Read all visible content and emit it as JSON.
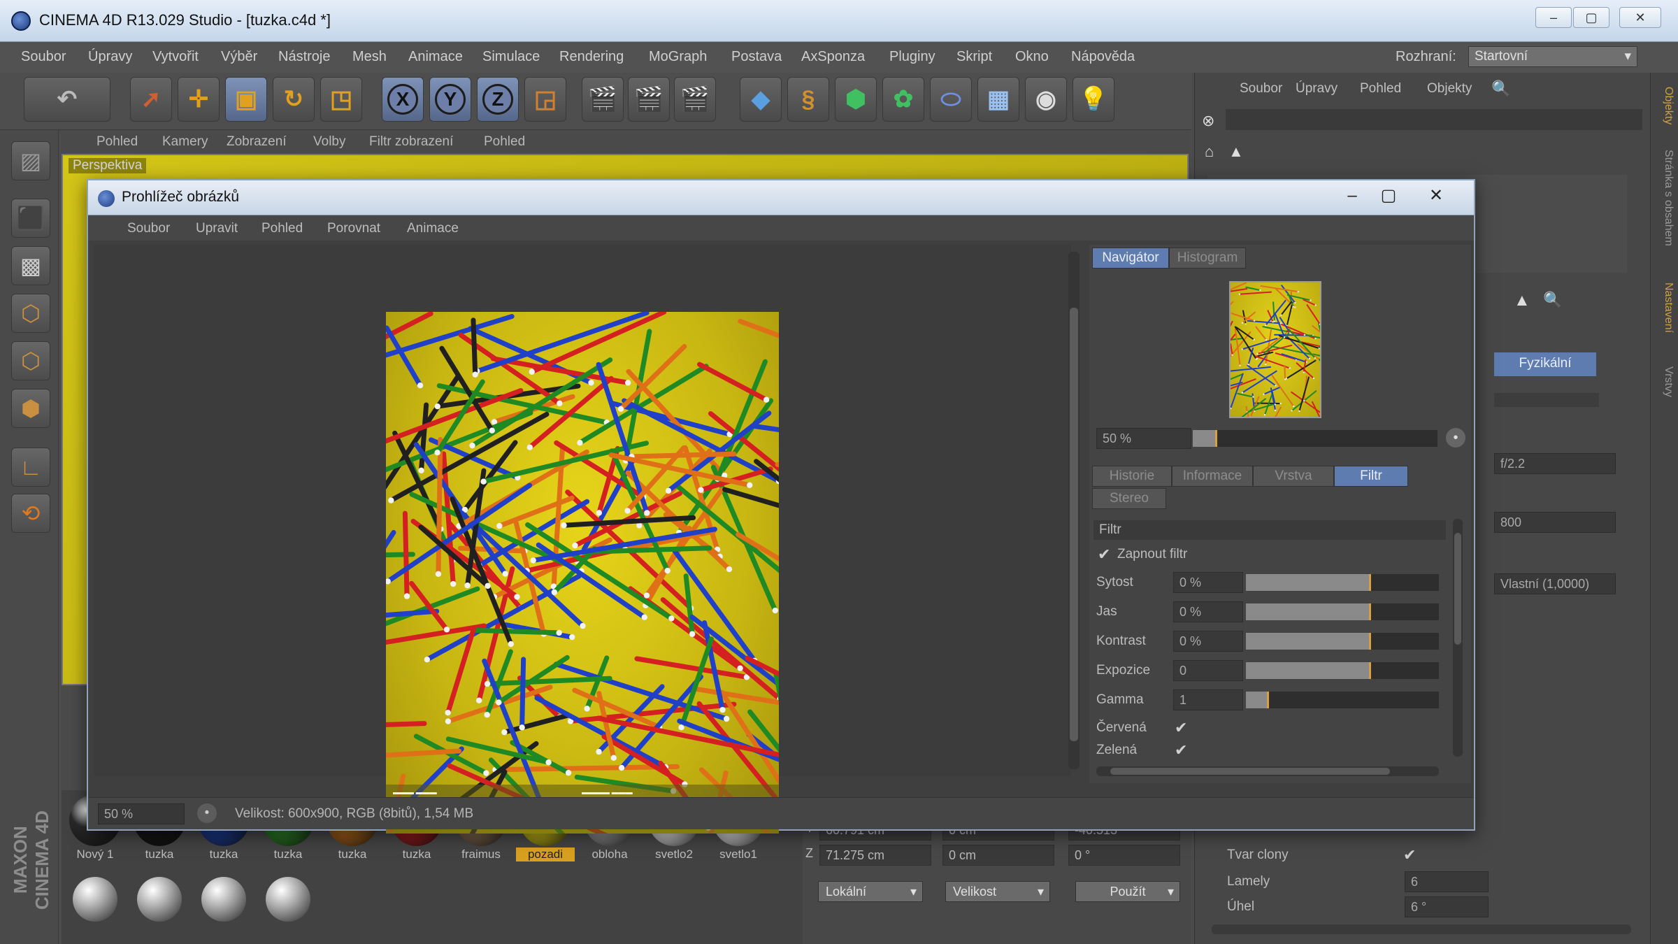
{
  "app": {
    "title": "CINEMA 4D R13.029 Studio - [tuzka.c4d *]",
    "window_controls": [
      "–",
      "▢",
      "✕"
    ]
  },
  "menubar": {
    "items": [
      "Soubor",
      "Úpravy",
      "Vytvořit",
      "Výběr",
      "Nástroje",
      "Mesh",
      "Animace",
      "Simulace",
      "Rendering",
      "MoGraph",
      "Postava",
      "AxSponza",
      "Pluginy",
      "Skript",
      "Okno",
      "Nápověda"
    ],
    "layout_label": "Rozhraní:",
    "layout_value": "Startovní"
  },
  "toolbar": {
    "axis_x": "X",
    "axis_y": "Y",
    "axis_z": "Z"
  },
  "viewport": {
    "menu": [
      "Pohled",
      "Kamery",
      "Zobrazení",
      "Volby",
      "Filtr zobrazení",
      "Pohled"
    ],
    "label": "Perspektiva"
  },
  "viewer": {
    "title": "Prohlížeč obrázků",
    "menu": [
      "Soubor",
      "Upravit",
      "Pohled",
      "Porovnat",
      "Animace"
    ],
    "panel_tabs": [
      "Navigátor",
      "Histogram"
    ],
    "zoom_value": "50 %",
    "zoom_fraction": 0.1,
    "section_tabs": [
      "Historie",
      "Informace",
      "Vrstva",
      "Filtr"
    ],
    "section_tab_active": "Filtr",
    "second_row_tab": "Stereo",
    "filter_header": "Filtr",
    "enable_filter_label": "Zapnout filtr",
    "enable_filter_checked": true,
    "filters": [
      {
        "label": "Sytost",
        "value": "0 %",
        "fraction": 0.65
      },
      {
        "label": "Jas",
        "value": "0 %",
        "fraction": 0.65
      },
      {
        "label": "Kontrast",
        "value": "0 %",
        "fraction": 0.65
      },
      {
        "label": "Expozice",
        "value": "0",
        "fraction": 0.65
      },
      {
        "label": "Gamma",
        "value": "1",
        "fraction": 0.12
      }
    ],
    "channels": [
      {
        "label": "Červená",
        "checked": true
      },
      {
        "label": "Zelená",
        "checked": true
      }
    ],
    "status_zoom": "50 %",
    "status_text": "Velikost: 600x900, RGB (8bitů), 1,54 MB"
  },
  "objmgr": {
    "menu": [
      "Soubor",
      "Úpravy",
      "Pohled",
      "Objekty"
    ]
  },
  "attrmgr": {
    "button_physical": "Fyzikální",
    "fields": [
      "f/2.2",
      "800",
      "Vlastní (1,0000)"
    ],
    "shape_label": "Tvar clony",
    "shape_checked": true,
    "lamellas_label": "Lamely",
    "lamellas_value": "6",
    "angle_label": "Úhel",
    "angle_value": "6 °"
  },
  "right_tabs": [
    "Objekty",
    "Stránka s obsahem",
    "Nastavení",
    "Vrstvy"
  ],
  "materials": [
    {
      "name": "Nový 1",
      "color": "#2a2a2a"
    },
    {
      "name": "tuzka",
      "color": "#151515"
    },
    {
      "name": "tuzka",
      "color": "#1c3f9e"
    },
    {
      "name": "tuzka",
      "color": "#2f8a25"
    },
    {
      "name": "tuzka",
      "color": "#b86a1a"
    },
    {
      "name": "tuzka",
      "color": "#a81c1c"
    },
    {
      "name": "fraimus",
      "color": "#8a7055"
    },
    {
      "name": "pozadi",
      "color": "#d4c617",
      "highlight": true
    },
    {
      "name": "obloha",
      "color": "#a0a0a0"
    },
    {
      "name": "svetlo2",
      "color": "#f2f2f2"
    },
    {
      "name": "svetlo1",
      "color": "#f2f2f2"
    }
  ],
  "coords": {
    "pos_x": "60.791 cm",
    "pos_z": "71.275 cm",
    "size_z": "0 cm",
    "size_z2": "0 cm",
    "rot_p": "-40.513 °",
    "rot_b": "0 °",
    "mode": "Lokální",
    "scale": "Velikost",
    "apply": "Použít"
  },
  "logo": "MAXON CINEMA 4D"
}
